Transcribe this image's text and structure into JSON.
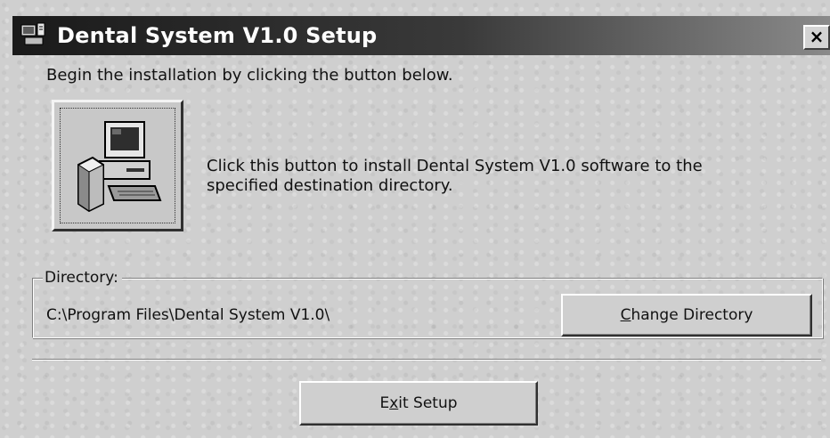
{
  "window": {
    "title": "Dental System V1.0 Setup",
    "close_label": "×",
    "app_icon": "setup-computer-icon"
  },
  "main": {
    "instruction": "Begin the installation by clicking the button below.",
    "install_button_icon": "computer-install-icon",
    "install_description": "Click this button to install Dental System V1.0 software to the specified destination directory."
  },
  "directory": {
    "legend": "Directory:",
    "path": "C:\\Program Files\\Dental System V1.0\\",
    "change_button": {
      "accel": "C",
      "rest": "hange Directory"
    }
  },
  "footer": {
    "exit_button": {
      "pre": "E",
      "accel": "x",
      "post": "it Setup"
    }
  },
  "colors": {
    "titlebar_start": "#1a1a1a",
    "titlebar_end": "#8a8a8a",
    "face": "#cfcfcf"
  }
}
